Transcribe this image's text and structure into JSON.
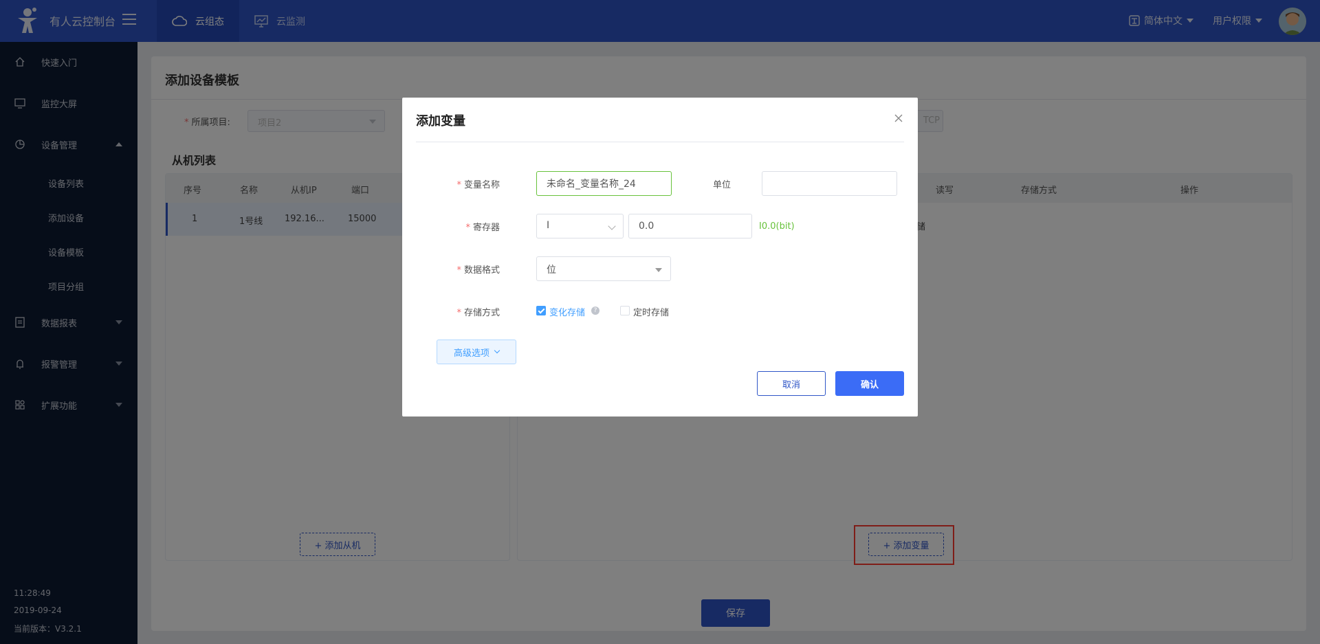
{
  "header": {
    "app_title": "有人云控制台",
    "tabs": [
      {
        "label": "云组态",
        "icon": "cloud-icon"
      },
      {
        "label": "云监测",
        "icon": "monitor-chart-icon"
      }
    ],
    "language": "简体中文",
    "user_menu": "用户权限"
  },
  "sidebar": {
    "items": [
      {
        "label": "快速入门",
        "icon": "home-icon"
      },
      {
        "label": "监控大屏",
        "icon": "monitor-icon"
      },
      {
        "label": "设备管理",
        "icon": "pie-chart-icon"
      },
      {
        "label": "数据报表",
        "icon": "document-icon"
      },
      {
        "label": "报警管理",
        "icon": "bell-icon"
      },
      {
        "label": "扩展功能",
        "icon": "grid-icon"
      }
    ],
    "device_submenu": [
      "设备列表",
      "添加设备",
      "设备模板",
      "项目分组"
    ],
    "footer": {
      "time": "11:28:49",
      "date": "2019-09-24",
      "version": "当前版本：V3.2.1"
    }
  },
  "page": {
    "title": "添加设备模板",
    "filters": {
      "project_label": "所属项目:",
      "project_value": "项目2",
      "protocol_value": "TCP"
    },
    "slave_list": {
      "title": "从机列表",
      "columns": [
        "序号",
        "名称",
        "从机IP",
        "端口"
      ],
      "rows": [
        {
          "index": "1",
          "name": "1号线",
          "ip": "192.16...",
          "port": "15000"
        }
      ],
      "add_button": "+ 添加从机"
    },
    "variable_list": {
      "columns": [
        "读写",
        "存储方式",
        "操作"
      ],
      "row_fragment": "储",
      "add_button": "+ 添加变量"
    },
    "save_button": "保存"
  },
  "dialog": {
    "title": "添加变量",
    "fields": {
      "var_name_label": "变量名称",
      "var_name_value": "未命名_变量名称_24",
      "unit_label": "单位",
      "unit_value": "",
      "register_label": "寄存器",
      "register_type": "I",
      "register_address": "0.0",
      "register_hint": "I0.0(bit)",
      "format_label": "数据格式",
      "format_value": "位",
      "storage_label": "存储方式",
      "storage_change": "变化存储",
      "storage_change_checked": true,
      "storage_timed": "定时存储",
      "storage_timed_checked": false
    },
    "advanced_button": "高级选项",
    "cancel_button": "取消",
    "confirm_button": "确认"
  },
  "colors": {
    "header_bg": "#2e55c7",
    "sidebar_bg": "#0d1a33",
    "primary": "#3b6cf6",
    "success": "#67c23a",
    "highlight_box": "#ff3b30"
  }
}
